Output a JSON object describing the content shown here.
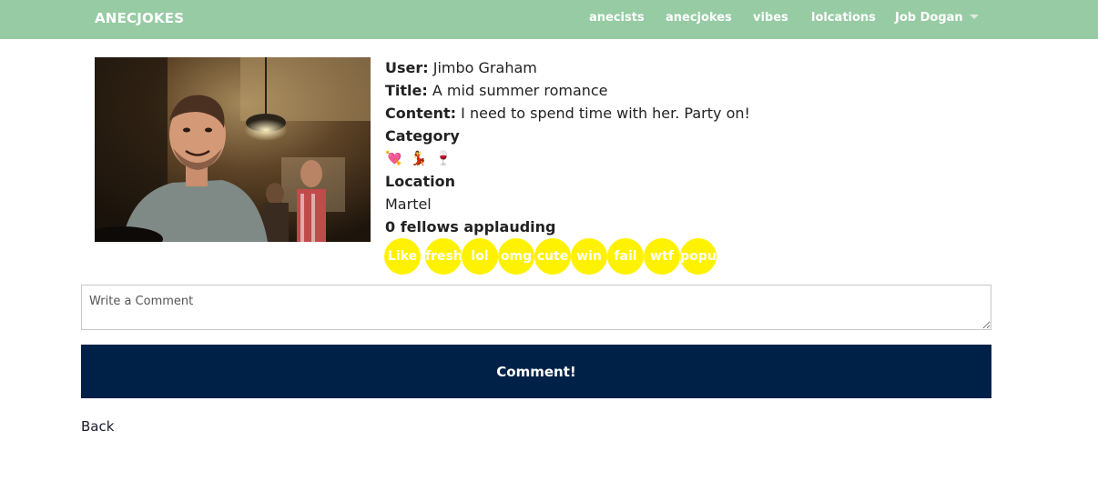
{
  "navbar": {
    "brand": "ANECJOKES",
    "links": [
      "anecists",
      "anecjokes",
      "vibes",
      "lolcations"
    ],
    "user_menu": "Job Dogan"
  },
  "post": {
    "photo_icon": "person-photo",
    "user_label": "User:",
    "user_value": "Jimbo Graham",
    "title_label": "Title:",
    "title_value": "A mid summer romance",
    "content_label": "Content:",
    "content_value": "I need to spend time with her. Party on!",
    "category_label": "Category",
    "category_emojis": "💘 💃 🍷",
    "location_label": "Location",
    "location_value": "Martel",
    "applause_text": "0 fellows applauding"
  },
  "reactions": [
    "Like",
    "fresh",
    "lol",
    "omg",
    "cute",
    "win",
    "fail",
    "wtf",
    "popu"
  ],
  "comment": {
    "placeholder": "Write a Comment",
    "button_label": "Comment!"
  },
  "back_label": "Back",
  "colors": {
    "navbar": "#97cba4",
    "reaction": "#fff200",
    "button": "#002147"
  }
}
